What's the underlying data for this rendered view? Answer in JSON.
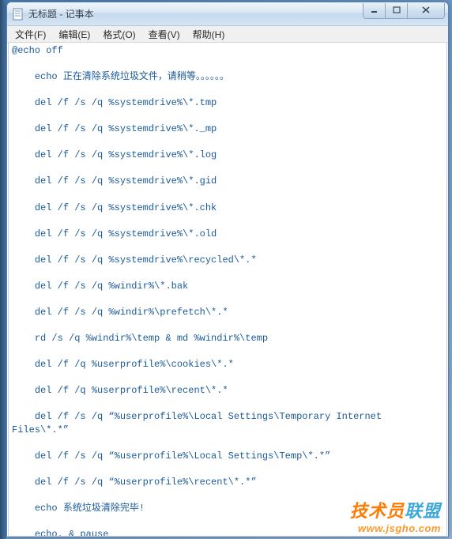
{
  "window": {
    "title": "无标题 - 记事本"
  },
  "menu": {
    "file": "文件(F)",
    "edit": "编辑(E)",
    "format": "格式(O)",
    "view": "查看(V)",
    "help": "帮助(H)"
  },
  "content": "@echo off\n\n    echo 正在清除系统垃圾文件，请稍等。。。。。。\n\n    del /f /s /q %systemdrive%\\*.tmp\n\n    del /f /s /q %systemdrive%\\*._mp\n\n    del /f /s /q %systemdrive%\\*.log\n\n    del /f /s /q %systemdrive%\\*.gid\n\n    del /f /s /q %systemdrive%\\*.chk\n\n    del /f /s /q %systemdrive%\\*.old\n\n    del /f /s /q %systemdrive%\\recycled\\*.*\n\n    del /f /s /q %windir%\\*.bak\n\n    del /f /s /q %windir%\\prefetch\\*.*\n\n    rd /s /q %windir%\\temp & md %windir%\\temp\n\n    del /f /q %userprofile%\\cookies\\*.*\n\n    del /f /q %userprofile%\\recent\\*.*\n\n    del /f /s /q “%userprofile%\\Local Settings\\Temporary Internet Files\\*.*”\n\n    del /f /s /q “%userprofile%\\Local Settings\\Temp\\*.*”\n\n    del /f /s /q “%userprofile%\\recent\\*.*”\n\n    echo 系统垃圾清除完毕!\n\n    echo. & pause",
  "watermark": {
    "brand_p1": "技术员",
    "brand_p2": "联盟",
    "url": "www.jsgho.com"
  }
}
